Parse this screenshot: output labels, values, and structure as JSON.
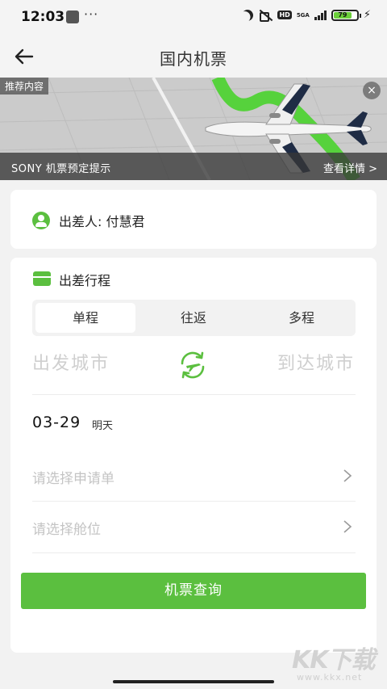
{
  "status_bar": {
    "time": "12:03",
    "dots": "···",
    "network": "5GA",
    "hd": "HD",
    "battery": "79"
  },
  "nav": {
    "title": "国内机票"
  },
  "banner": {
    "tag": "推荐内容",
    "close": "×",
    "caption": "SONY 机票预定提示",
    "detail": "查看详情 >"
  },
  "traveler": {
    "label": "出差人: 付慧君"
  },
  "trip": {
    "title": "出差行程",
    "tabs": [
      {
        "label": "单程",
        "active": true
      },
      {
        "label": "往返",
        "active": false
      },
      {
        "label": "多程",
        "active": false
      }
    ],
    "from_placeholder": "出发城市",
    "to_placeholder": "到达城市",
    "date": "03-29",
    "date_sub": "明天",
    "application_placeholder": "请选择申请单",
    "cabin_placeholder": "请选择舱位",
    "search_button": "机票查询"
  },
  "watermark": {
    "logo": "KK下载",
    "url": "www.kkx.net"
  },
  "colors": {
    "accent": "#5bbf3f",
    "background": "#f2f2f2"
  }
}
